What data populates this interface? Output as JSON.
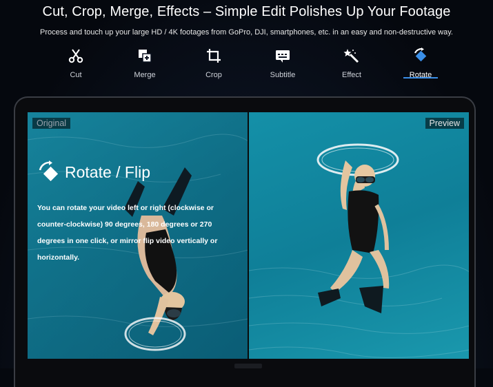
{
  "header": {
    "title": "Cut, Crop, Merge, Effects – Simple Edit Polishes Up Your Footage",
    "subtitle": "Process and touch up your large HD / 4K footages from GoPro, DJI, smartphones, etc. in an easy and non-destructive way."
  },
  "tabs": [
    {
      "label": "Cut",
      "icon": "scissors-icon"
    },
    {
      "label": "Merge",
      "icon": "merge-icon"
    },
    {
      "label": "Crop",
      "icon": "crop-icon"
    },
    {
      "label": "Subtitle",
      "icon": "subtitle-icon"
    },
    {
      "label": "Effect",
      "icon": "magic-wand-icon"
    },
    {
      "label": "Rotate",
      "icon": "rotate-icon",
      "active": true
    }
  ],
  "preview": {
    "original_label": "Original",
    "preview_label": "Preview",
    "heading": "Rotate / Flip",
    "description": "You can rotate your video left or right (clockwise or counter-clockwise) 90 degrees, 180 degrees or 270 degrees in one click, or mirror flip video vertically or horizontally."
  },
  "colors": {
    "accent": "#3a8fe8",
    "water": "#137e96"
  }
}
